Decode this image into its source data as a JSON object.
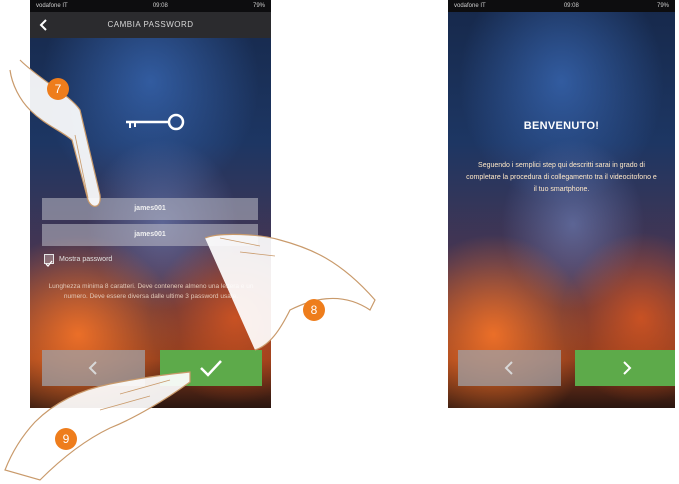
{
  "left_screen": {
    "status_bar": {
      "carrier": "vodafone IT",
      "time": "09:08",
      "battery": "79%"
    },
    "title": "CAMBIA PASSWORD",
    "password_field": "james001",
    "confirm_field": "james001",
    "show_password_label": "Mostra password",
    "show_password_checked": true,
    "help_text": "Lunghezza minima 8 caratteri. Deve contenere almeno una lettera e un numero. Deve essere diversa dalle ultime 3 password usate.",
    "back_icon": "chevron-left-icon",
    "confirm_icon": "checkmark-icon"
  },
  "right_screen": {
    "status_bar": {
      "carrier": "vodafone IT",
      "time": "09:08",
      "battery": "79%"
    },
    "welcome_title": "BENVENUTO!",
    "welcome_text": "Seguendo i semplici step qui descritti sarai in grado di completare la procedura di collegamento tra il videocitofono e il tuo smartphone.",
    "prev_icon": "chevron-left-icon",
    "next_icon": "chevron-right-icon"
  },
  "steps": {
    "step_7": "7",
    "step_8": "8",
    "step_9": "9"
  },
  "colors": {
    "accent_orange": "#ee7d1c",
    "confirm_green": "#5daa4a",
    "titlebar": "#2b2b2e"
  }
}
